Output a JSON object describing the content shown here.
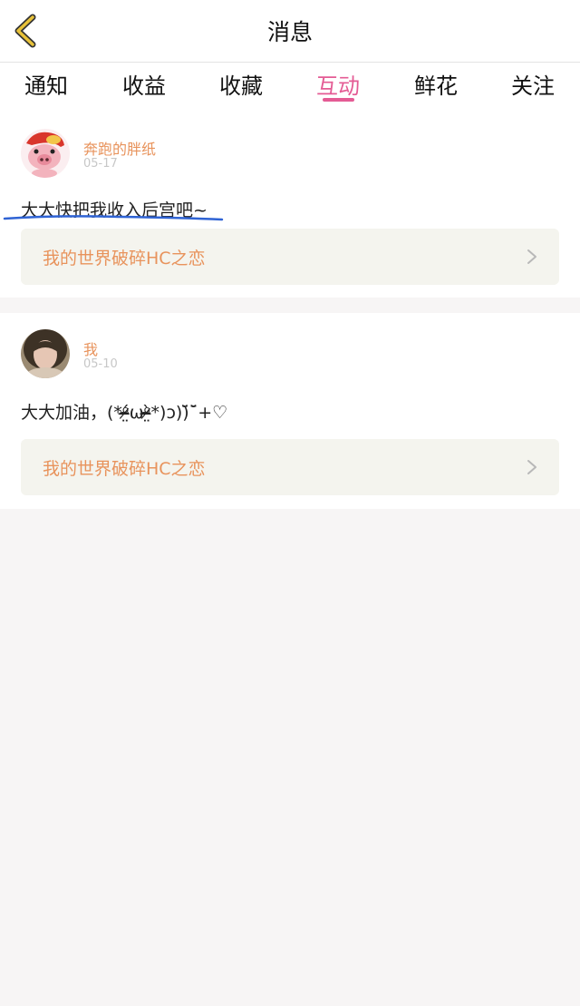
{
  "header": {
    "title": "消息",
    "back_icon": "chevron-left-icon",
    "back_color": "#e8c23a"
  },
  "tabs": [
    {
      "label": "通知",
      "active": false
    },
    {
      "label": "收益",
      "active": false
    },
    {
      "label": "收藏",
      "active": false
    },
    {
      "label": "互动",
      "active": true
    },
    {
      "label": "鲜花",
      "active": false
    },
    {
      "label": "关注",
      "active": false
    }
  ],
  "colors": {
    "accent": "#e45b94",
    "username": "#e8935c",
    "date": "#c7c7c7",
    "annotation": "#2f63d4"
  },
  "messages": [
    {
      "user": "奔跑的胖纸",
      "date": "05-17",
      "text": "大大快把我收入后宫吧~",
      "book": "我的世界破碎HC之恋",
      "avatar": "pig-cartoon-avatar"
    },
    {
      "user": "我",
      "date": "05-10",
      "text": "大大加油，(*ᵒ̴̶̷̤́ωᵒ̴̶̷̤̀*)ɔ))̆̈ˉ̈̆+♡",
      "book": "我的世界破碎HC之恋",
      "avatar": "girl-photo-avatar"
    }
  ]
}
